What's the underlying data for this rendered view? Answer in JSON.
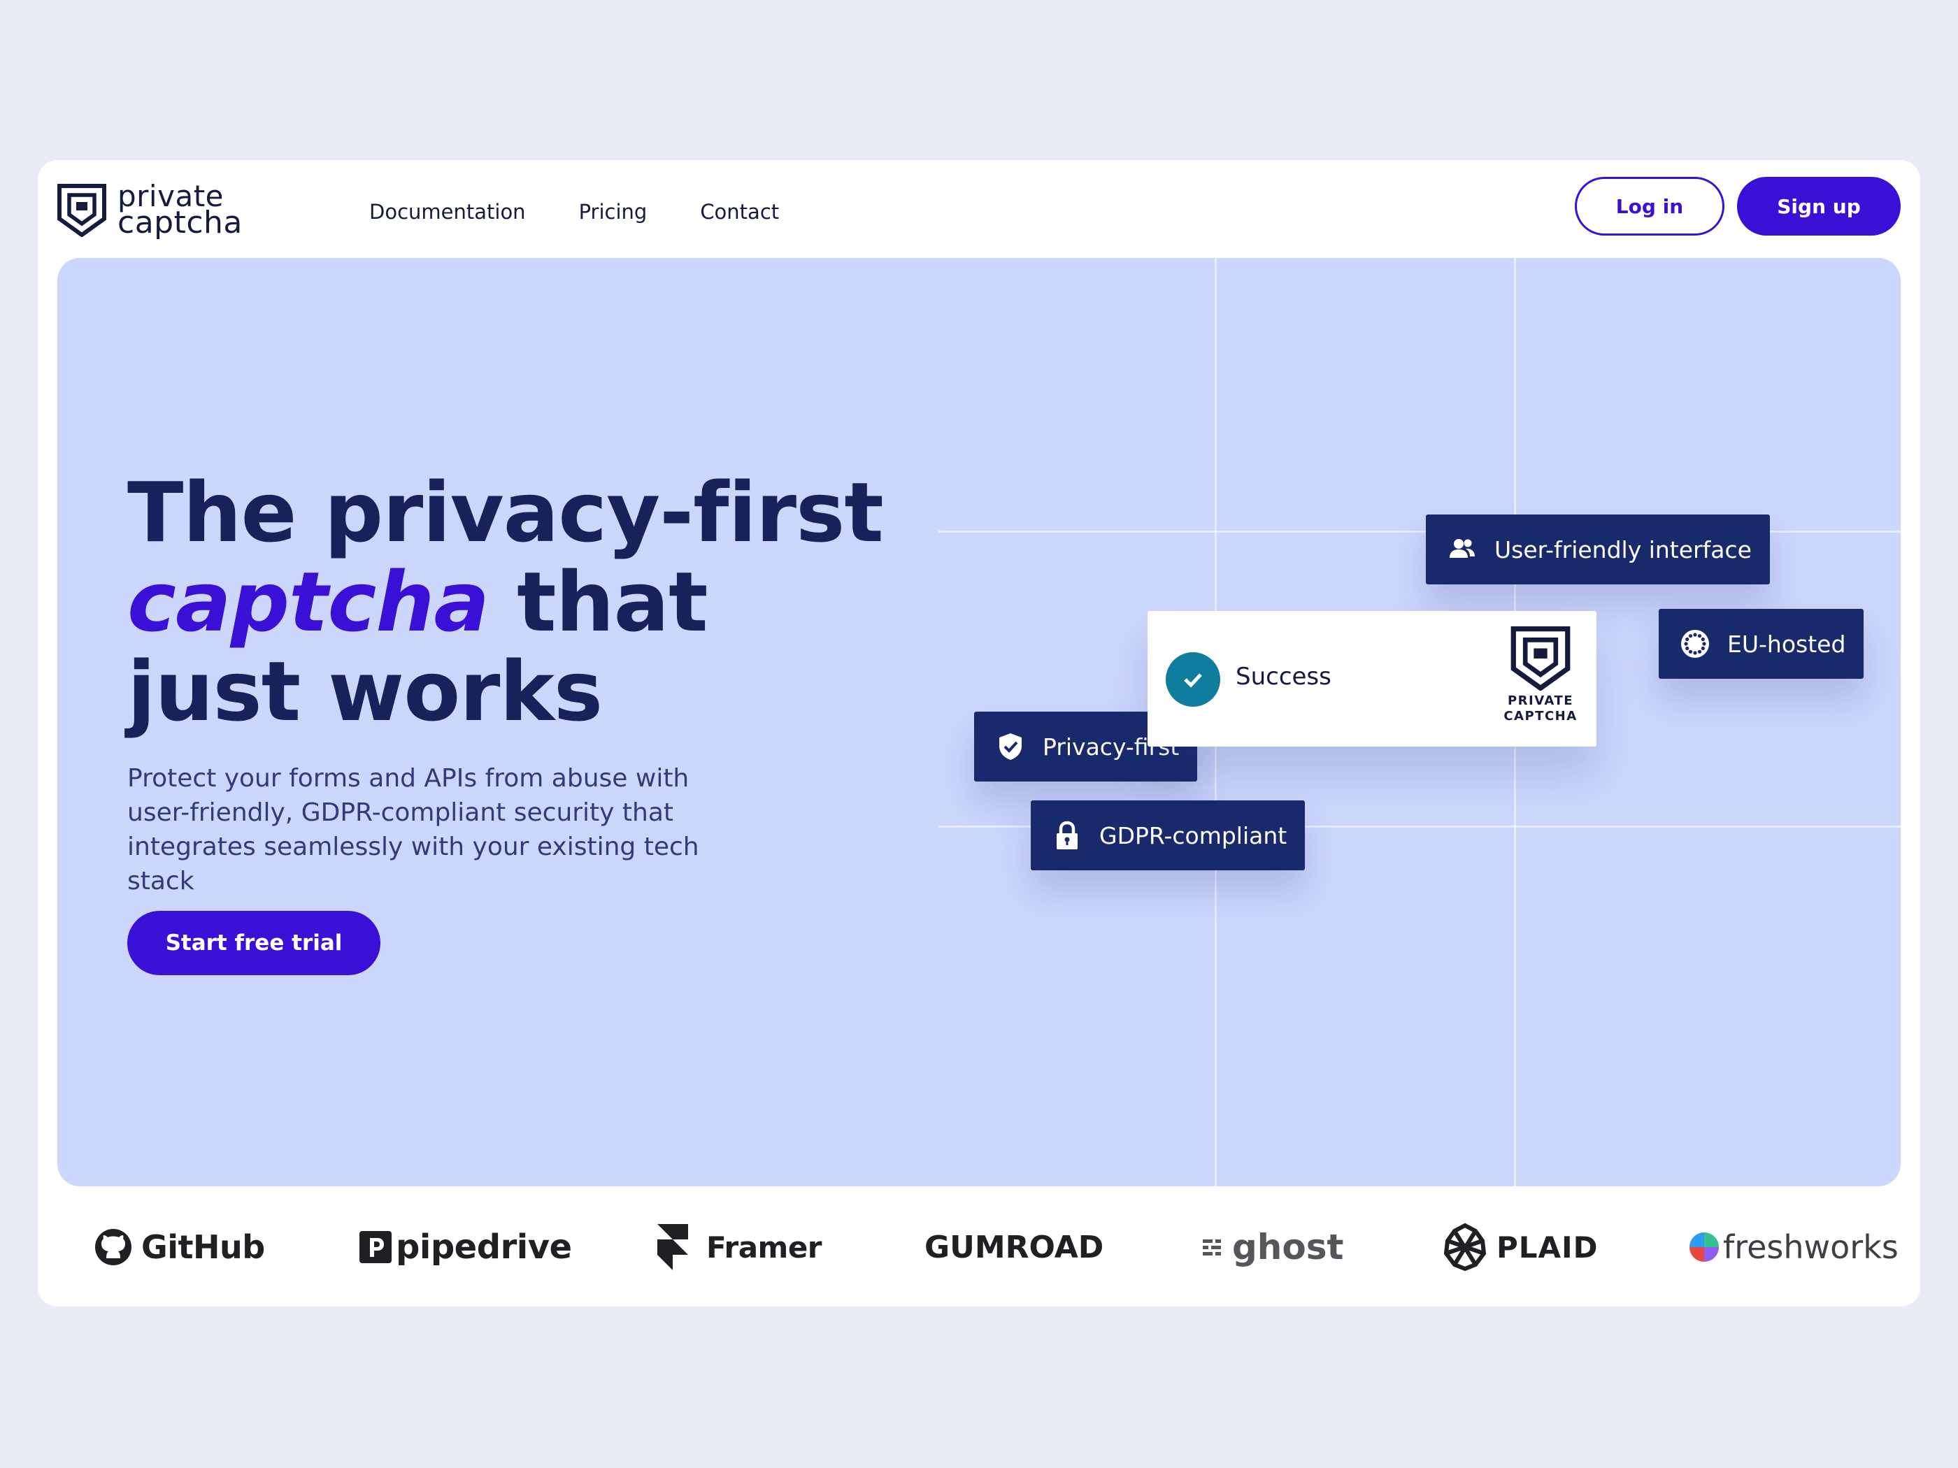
{
  "brand": {
    "line1": "private",
    "line2": "captcha"
  },
  "nav": [
    "Documentation",
    "Pricing",
    "Contact"
  ],
  "auth": {
    "login": "Log in",
    "signup": "Sign up"
  },
  "hero": {
    "headline_line1": "The privacy-first",
    "headline_accent": "captcha",
    "headline_line2_rest": " that",
    "headline_line3": "just works",
    "subtext": "Protect your forms and APIs from abuse with user-friendly, GDPR-compliant security that integrates seamlessly with your existing tech stack",
    "cta": "Start free trial"
  },
  "widget": {
    "status": "Success",
    "logo_line1": "PRIVATE",
    "logo_line2": "CAPTCHA"
  },
  "tags": {
    "user_friendly": "User-friendly interface",
    "eu_hosted": "EU-hosted",
    "privacy_first": "Privacy-first",
    "gdpr": "GDPR-compliant"
  },
  "clients": [
    "GitHub",
    "pipedrive",
    "Framer",
    "GUMROAD",
    "ghost",
    "PLAID",
    "freshworks"
  ],
  "colors": {
    "accent": "#3a0fd6",
    "navy": "#18225a",
    "hero_bg": "#cdd6fc",
    "tag_bg": "#182a6b",
    "check": "#0f7e9e"
  }
}
